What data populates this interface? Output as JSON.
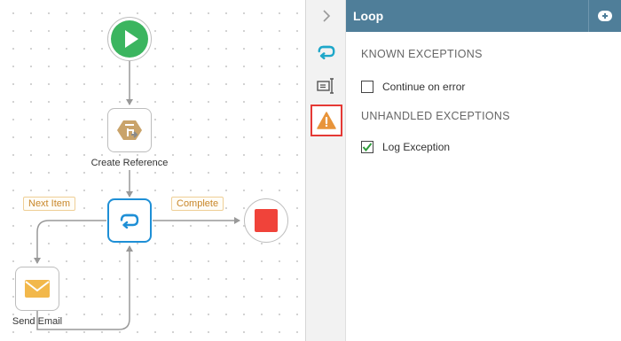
{
  "canvas": {
    "nodes": {
      "start": {
        "icon": "play-icon",
        "color": "#3bb55f"
      },
      "create_reference": {
        "label": "Create Reference",
        "icon": "reference-icon",
        "color": "#c9a36a"
      },
      "loop": {
        "icon": "loop-icon",
        "color": "#1e8fd6"
      },
      "stop": {
        "icon": "stop-icon",
        "color": "#f0433a"
      },
      "send_email": {
        "label": "Send Email",
        "icon": "envelope-icon",
        "color": "#f2b84b"
      }
    },
    "paths": {
      "next_item": "Next Item",
      "complete": "Complete"
    }
  },
  "rail": {
    "items": [
      {
        "icon": "chevron-right-icon"
      },
      {
        "icon": "loop-icon"
      },
      {
        "icon": "text-field-icon"
      },
      {
        "icon": "warning-icon",
        "active": true
      }
    ]
  },
  "panel": {
    "title": "Loop",
    "header_action_icon": "add-icon",
    "known_exceptions": {
      "title": "KNOWN EXCEPTIONS",
      "options": [
        {
          "label": "Continue on error",
          "checked": false
        }
      ]
    },
    "unhandled_exceptions": {
      "title": "UNHANDLED EXCEPTIONS",
      "options": [
        {
          "label": "Log Exception",
          "checked": true
        }
      ]
    }
  },
  "colors": {
    "header_bg": "#4f7e99",
    "accent_blue": "#1e8fd6",
    "active_border": "#e53935",
    "warning": "#e8943a",
    "check": "#2e9b3a"
  }
}
